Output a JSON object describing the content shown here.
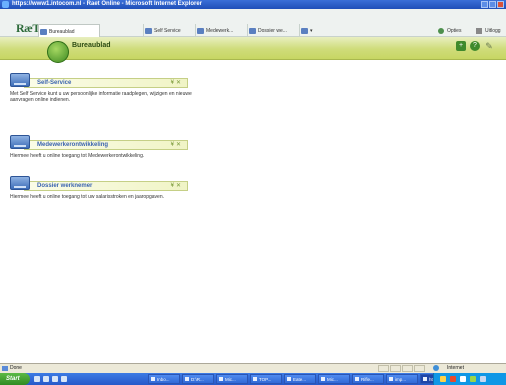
{
  "window": {
    "title": "https://www1.intocom.nl - Raet Online - Microsoft Internet Explorer"
  },
  "app": {
    "logo_text": "RæT",
    "tabs": [
      {
        "label": "Bureaublad",
        "active": true
      },
      {
        "label": "Self Service",
        "active": false
      },
      {
        "label": "Medewerk...",
        "active": false
      },
      {
        "label": "Dossier we...",
        "active": false
      },
      {
        "label": "",
        "active": false
      }
    ],
    "right_links": [
      {
        "label": "Opties"
      },
      {
        "label": "Uitlogg"
      }
    ]
  },
  "page": {
    "title": "Bureaublad"
  },
  "sections": [
    {
      "title": "Self-Service",
      "description": "Met Self Service kunt u uw persoonlijke informatie raadplegen, wijzigen en nieuwe aanvragen online indienen."
    },
    {
      "title": "Medewerkerontwikkeling",
      "description": "Hiermee heeft u online toegang tot Medewerkerontwikkeling."
    },
    {
      "title": "Dossier werknemer",
      "description": "Hiermee heeft u online toegang tot uw salarisstroken en jaaropgaven."
    }
  ],
  "status": {
    "left": "Done",
    "zone": "Internet"
  },
  "taskbar": {
    "start_label": "Start",
    "tasks": [
      {
        "label": "Inbo..."
      },
      {
        "label": "D:\\R..."
      },
      {
        "label": "Mic..."
      },
      {
        "label": "TOP..."
      },
      {
        "label": "Eate..."
      },
      {
        "label": "Mic..."
      },
      {
        "label": "Rifle..."
      },
      {
        "label": "imp..."
      },
      {
        "label": "http..."
      }
    ]
  }
}
